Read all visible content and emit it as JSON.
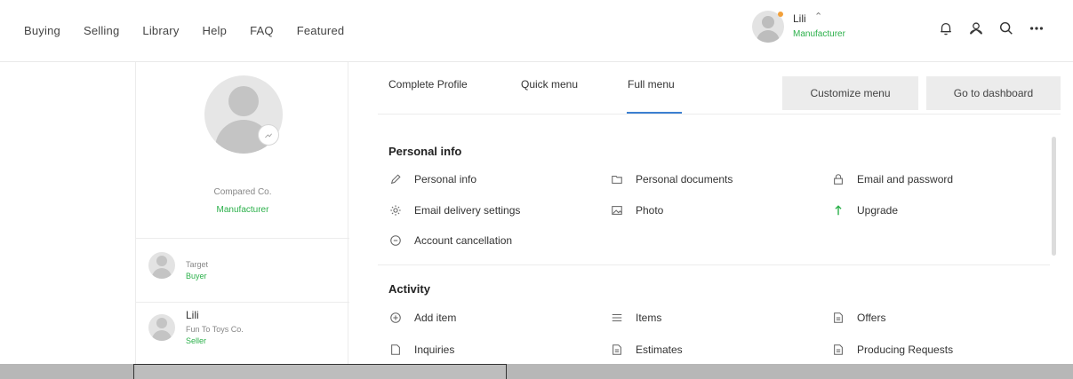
{
  "nav": {
    "links": [
      "Buying",
      "Selling",
      "Library",
      "Help",
      "FAQ",
      "Featured"
    ]
  },
  "user": {
    "name": "Lili",
    "role": "Manufacturer",
    "chevron_icon": "chevron-up-icon",
    "status_color": "#f2a03a"
  },
  "header_icons": [
    "bell-icon",
    "users-icon",
    "search-icon",
    "more-icon"
  ],
  "profile": {
    "company": "Compared Co.",
    "role": "Manufacturer",
    "accounts": [
      {
        "name": "Target",
        "role": "Buyer"
      },
      {
        "name": "Lili",
        "company": "Fun To Toys Co.",
        "role": "Seller"
      }
    ]
  },
  "tabs": [
    {
      "label": "Complete Profile",
      "active": false
    },
    {
      "label": "Quick menu",
      "active": false
    },
    {
      "label": "Full menu",
      "active": true
    }
  ],
  "buttons": {
    "customize": "Customize menu",
    "dashboard": "Go to dashboard"
  },
  "sections": {
    "personal": {
      "title": "Personal info",
      "items": [
        {
          "label": "Personal info",
          "icon": "pencil-icon"
        },
        {
          "label": "Personal documents",
          "icon": "folder-icon"
        },
        {
          "label": "Email and password",
          "icon": "lock-icon"
        },
        {
          "label": "Email delivery settings",
          "icon": "gear-icon"
        },
        {
          "label": "Photo",
          "icon": "image-icon"
        },
        {
          "label": "Upgrade",
          "icon": "arrow-up-icon"
        },
        {
          "label": "Account cancellation",
          "icon": "cancel-icon"
        }
      ]
    },
    "activity": {
      "title": "Activity",
      "items": [
        {
          "label": "Add item",
          "icon": "plus-circle-icon"
        },
        {
          "label": "Items",
          "icon": "list-icon"
        },
        {
          "label": "Offers",
          "icon": "document-icon"
        },
        {
          "label": "Inquiries",
          "icon": "document-icon"
        },
        {
          "label": "Estimates",
          "icon": "document-icon"
        },
        {
          "label": "Producing Requests",
          "icon": "document-icon"
        }
      ]
    }
  },
  "colors": {
    "accent_green": "#2bb04a",
    "tab_underline": "#3c7fd1",
    "upgrade_arrow": "#2bb04a",
    "button_bg": "#ececec"
  }
}
